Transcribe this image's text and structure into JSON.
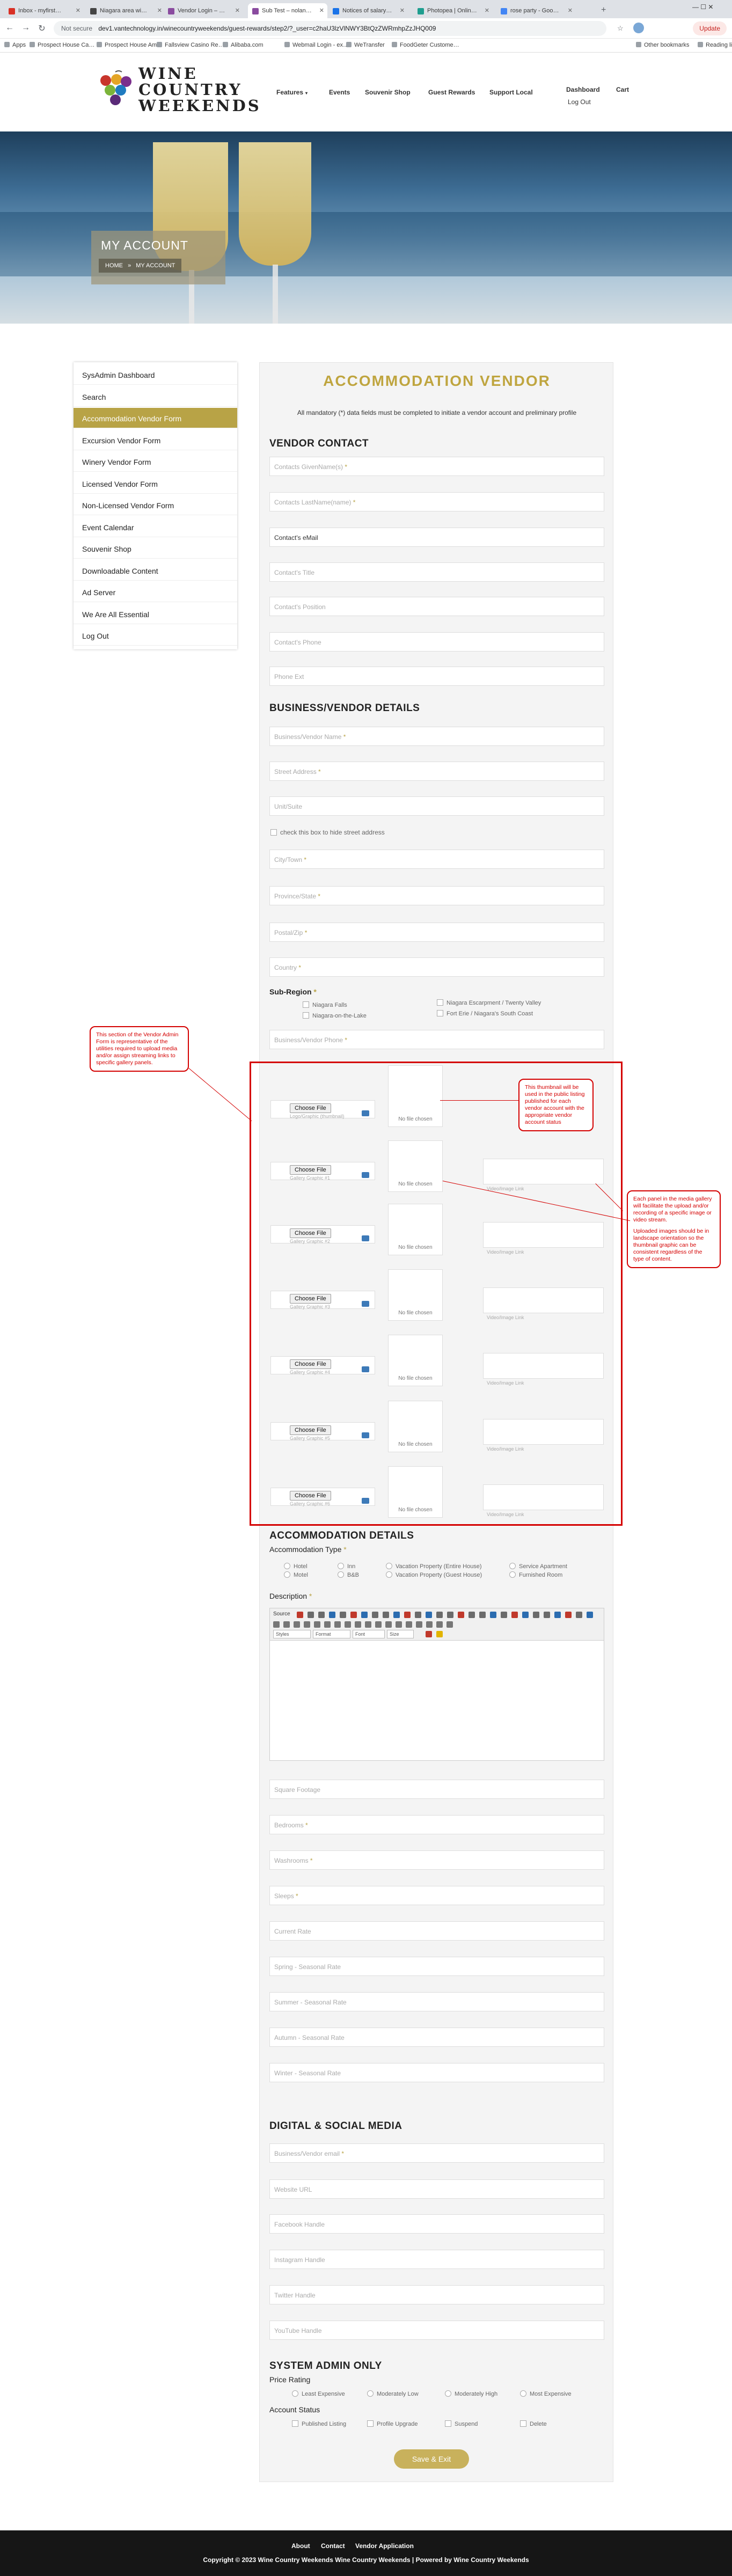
{
  "browser": {
    "tabs": [
      {
        "label": "Inbox - myfirst…",
        "color": "#d93025"
      },
      {
        "label": "Niagara area wi…",
        "color": "#444"
      },
      {
        "label": "Vendor Login – …",
        "color": "#8a4b9f"
      },
      {
        "label": "Sub Test – nolan…",
        "color": "#8a4b9f"
      },
      {
        "label": "Notices of salary…",
        "color": "#1a73e8"
      },
      {
        "label": "Photopea | Onlin…",
        "color": "#1f9e8f"
      },
      {
        "label": "rose party - Goo…",
        "color": "#4285f4"
      }
    ],
    "not_secure": "Not secure",
    "url": "dev1.vantechnology.in/winecountryweekends/guest-rewards/step2/?_user=c2haU3lzVlNWY3BtQzZWRmhpZzJHQ009",
    "update": "Update",
    "bookmarks": [
      "Apps",
      "Prospect House Ca…",
      "Prospect House Am…",
      "Fallsview Casino Re…",
      "Alibaba.com",
      "Webmail Login - ex…",
      "WeTransfer",
      "FoodGeter Custome…",
      "Other bookmarks",
      "Reading list"
    ]
  },
  "header": {
    "logo_line1": "WINE",
    "logo_line2": "COUNTRY",
    "logo_line3": "WEEKENDS",
    "nav": [
      "Features",
      "Events",
      "Souvenir Shop",
      "Guest Rewards",
      "Support Local"
    ],
    "dashboard": "Dashboard",
    "logout": "Log Out",
    "cart": "Cart"
  },
  "hero": {
    "title": "MY ACCOUNT",
    "home": "HOME",
    "sep": "»",
    "current": "MY ACCOUNT"
  },
  "sidebar": [
    "SysAdmin Dashboard",
    "Search",
    "Accommodation Vendor Form",
    "Excursion Vendor Form",
    "Winery Vendor Form",
    "Licensed Vendor Form",
    "Non-Licensed Vendor Form",
    "Event Calendar",
    "Souvenir Shop",
    "Downloadable Content",
    "Ad Server",
    "We Are All Essential",
    "Log Out"
  ],
  "form": {
    "title": "ACCOMMODATION  VENDOR",
    "note": "All mandatory (*) data fields must be completed to initiate a vendor account and preliminary profile",
    "contact_heading": "VENDOR CONTACT",
    "contact_fields": [
      "Contacts GivenName(s)",
      "Contacts LastName(name)",
      "Contact's eMail",
      "Contact's Title",
      "Contact's Position",
      "Contact's Phone",
      "Phone Ext"
    ],
    "business_heading": "BUSINESS/VENDOR  DETAILS",
    "business_fields": [
      "Business/Vendor Name",
      "Street Address",
      "Unit/Suite"
    ],
    "hide_street": "check this box to hide street address",
    "business_fields2": [
      "City/Town",
      "Province/State",
      "Postal/Zip",
      "Country"
    ],
    "subregion_label": "Sub-Region",
    "subregions": [
      "Niagara Falls",
      "Niagara-on-the-Lake",
      "Niagara Escarpment / Twenty Valley",
      "Fort Erie / Niagara's South Coast"
    ],
    "business_phone": "Business/Vendor Phone",
    "choose_file": "Choose File",
    "logo_caption": "Logo/Graphic (thumbnail)",
    "gallery_captions": [
      "Gallery Graphic #1",
      "Gallery Graphic #2",
      "Gallery Graphic #3",
      "Gallery Graphic #4",
      "Gallery Graphic #5",
      "Gallery Graphic #6"
    ],
    "no_file": "No file chosen",
    "video_link": "Video/Image Link",
    "acc_heading": "ACCOMMODATION DETAILS",
    "acc_type_label": "Accommodation Type",
    "acc_types": [
      "Hotel",
      "Motel",
      "Inn",
      "B&B",
      "Vacation Property (Entire House)",
      "Vacation Property (Guest House)",
      "Service Apartment",
      "Furnished Room"
    ],
    "description_label": "Description",
    "editor_source": "Source",
    "editor_styles": [
      "Styles",
      "Format",
      "Font",
      "Size"
    ],
    "detail_fields": [
      "Square Footage",
      "Bedrooms",
      "Washrooms",
      "Sleeps",
      "Current Rate",
      "Spring - Seasonal Rate",
      "Summer - Seasonal Rate",
      "Autumn - Seasonal Rate",
      "Winter - Seasonal Rate"
    ],
    "digital_heading": "DIGITAL & SOCIAL MEDIA",
    "digital_fields": [
      "Business/Vendor email",
      "Website URL",
      "Facebook Handle",
      "Instagram Handle",
      "Twitter Handle",
      "YouTube Handle"
    ],
    "admin_heading": "SYSTEM ADMIN ONLY",
    "price_label": "Price Rating",
    "prices": [
      "Least Expensive",
      "Moderately Low",
      "Moderately High",
      "Most Expensive"
    ],
    "status_label": "Account Status",
    "statuses": [
      "Published Listing",
      "Profile Upgrade",
      "Suspend",
      "Delete"
    ],
    "save": "Save & Exit"
  },
  "notes": {
    "left": "This section of the Vendor Admin Form is representative of the utilities required to upload media and/or assign streaming links to specific gallery panels.",
    "thumb": "This thumbnail will be used in the public listing published for each vendor account with the appropriate vendor account status",
    "right": "Each panel in the media gallery will facilitate the upload and/or recording of a specific image or video stream.",
    "right2": "Uploaded images should be in landscape orientation so the thumbnail graphic can be consistent regardless of the type of content."
  },
  "footer": {
    "links": [
      "About",
      "Contact",
      "Vendor Application"
    ],
    "copyright": "Copyright © 2023 Wine Country Weekends Wine Country Weekends | Powered by Wine Country Weekends"
  }
}
